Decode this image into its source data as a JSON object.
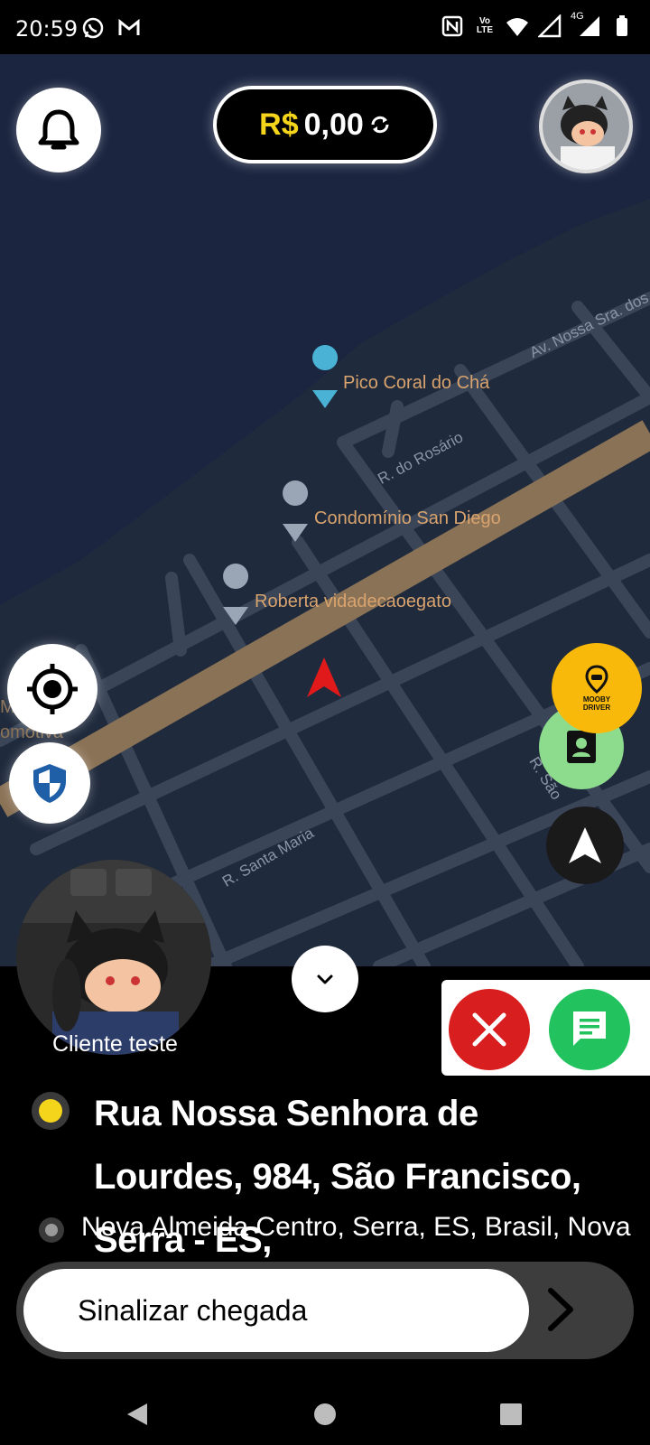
{
  "status_bar": {
    "time": "20:59",
    "left_icons": [
      "whatsapp-icon",
      "gmail-icon"
    ],
    "right_icons": [
      "nfc-icon",
      "volte-icon",
      "wifi-icon",
      "signal-icon",
      "signal-4g-icon",
      "battery-icon"
    ],
    "volte_text": "Vo LTE",
    "network_text": "4G"
  },
  "header": {
    "balance_currency": "R$",
    "balance_value": "0,00"
  },
  "map": {
    "pois": [
      "Pico Coral do Chá",
      "Condomínio San Diego",
      "Roberta vidadecaoegato"
    ],
    "streets": [
      "Av. Nossa Sra. dos",
      "R. do Rosário",
      "R. Santa Maria",
      "R. São"
    ],
    "edge_labels": [
      "Me",
      "omotiva"
    ],
    "brand_badge": "MOOBY DRIVER",
    "colors": {
      "water": "#1b2540",
      "land": "#1f2a3c",
      "avenue": "#8a7256",
      "street": "#3a4658"
    }
  },
  "trip": {
    "client_name": "Cliente teste",
    "pickup_address": "Rua Nossa Senhora de Lourdes, 984, São Francisco, Serra - ES,",
    "destination_address": "Nova Almeida Centro, Serra, ES, Brasil, Nova",
    "slide_label": "Sinalizar chegada"
  },
  "colors": {
    "accent_yellow": "#f5d51c",
    "cancel_red": "#d81e1e",
    "chat_green": "#22c35e",
    "contact_green": "#8ddc8d"
  }
}
